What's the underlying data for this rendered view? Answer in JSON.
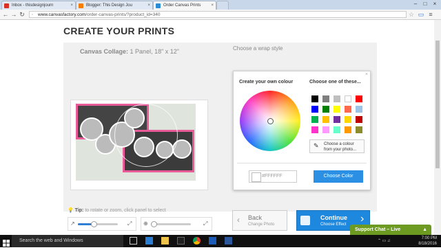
{
  "browser": {
    "tabs": [
      {
        "title": "Inbox - thisdesignjourn"
      },
      {
        "title": "Blogger: This Design Jou"
      },
      {
        "title": "Order Canvas Prints"
      }
    ],
    "url_host": "www.canvasfactory.com",
    "url_path": "/order-canvas-prints/?product_id=340"
  },
  "page": {
    "heading": "CREATE YOUR PRINTS",
    "product_label": "Canvas Collage:",
    "product_value": "1 Panel, 18\" x 12\"",
    "wrap_label": "Choose a wrap style",
    "tip_label": "Tip:",
    "tip_text": "to rotate or zoom, click panel to select",
    "rotate_slider_value": 0.38,
    "zoom_slider_value": 0.05
  },
  "color_popup": {
    "own_colour_title": "Create your own colour",
    "choose_title": "Choose one of these...",
    "swatches": [
      "#000000",
      "#7f7f7f",
      "#bfbfbf",
      "#ffffff",
      "#ff0000",
      "#0000ff",
      "#008000",
      "#ffff00",
      "#ff6a4d",
      "#9dc3e6",
      "#00b050",
      "#ffc000",
      "#7030a0",
      "#ffd700",
      "#c00000",
      "#ff33cc",
      "#ff99ff",
      "#66ffcc",
      "#ff9900",
      "#8c8c2d"
    ],
    "choose_photo_line1": "Choose a colour",
    "choose_photo_line2": "from your photo...",
    "hex_value": "#FFFFFF",
    "apply_label": "Choose Color"
  },
  "buttons": {
    "back_label": "Back",
    "back_sub": "Change Photo",
    "continue_label": "Continue",
    "continue_sub": "Choose Effect"
  },
  "chat": {
    "label": "Support Chat – Live"
  },
  "taskbar": {
    "search_placeholder": "Search the web and Windows",
    "time": "7:00 PM",
    "date": "8/18/2016"
  },
  "colors": {
    "accent_blue": "#1e87de",
    "pink_frame": "#e95a99",
    "chat_green": "#6d9a20"
  }
}
